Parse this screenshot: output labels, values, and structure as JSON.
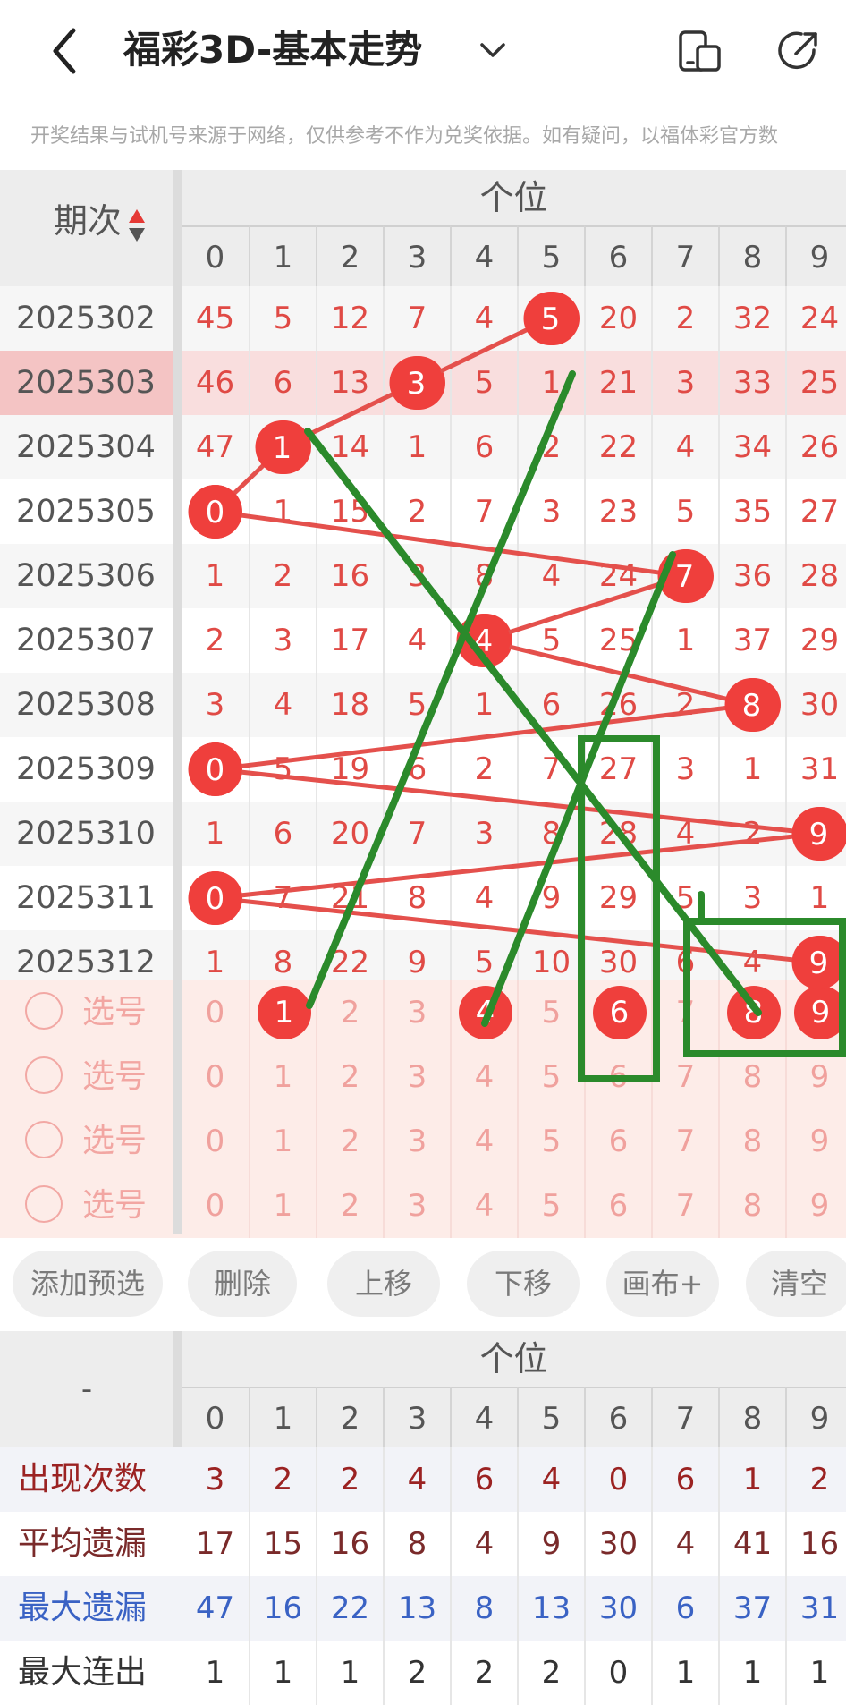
{
  "header": {
    "title": "福彩3D-基本走势",
    "icons": [
      "back-arrow-icon",
      "chevron-down-icon",
      "phone-layout-icon",
      "share-icon"
    ]
  },
  "disclaimer": "开奖结果与试机号来源于网络，仅供参考不作为兑奖依据。如有疑问，以福体彩官方数",
  "table": {
    "issue_header": "期次",
    "group_header": "个位",
    "columns": [
      "0",
      "1",
      "2",
      "3",
      "4",
      "5",
      "6",
      "7",
      "8",
      "9"
    ],
    "rows": [
      {
        "issue": "2025302",
        "values": [
          "45",
          "5",
          "12",
          "7",
          "4",
          "5",
          "20",
          "2",
          "32",
          "24"
        ],
        "hit": 5
      },
      {
        "issue": "2025303",
        "values": [
          "46",
          "6",
          "13",
          "3",
          "5",
          "1",
          "21",
          "3",
          "33",
          "25"
        ],
        "hit": 3
      },
      {
        "issue": "2025304",
        "values": [
          "47",
          "1",
          "14",
          "1",
          "6",
          "2",
          "22",
          "4",
          "34",
          "26"
        ],
        "hit": 1
      },
      {
        "issue": "2025305",
        "values": [
          "0",
          "1",
          "15",
          "2",
          "7",
          "3",
          "23",
          "5",
          "35",
          "27"
        ],
        "hit": 0
      },
      {
        "issue": "2025306",
        "values": [
          "1",
          "2",
          "16",
          "3",
          "8",
          "4",
          "24",
          "7",
          "36",
          "28"
        ],
        "hit": 7
      },
      {
        "issue": "2025307",
        "values": [
          "2",
          "3",
          "17",
          "4",
          "4",
          "5",
          "25",
          "1",
          "37",
          "29"
        ],
        "hit": 4
      },
      {
        "issue": "2025308",
        "values": [
          "3",
          "4",
          "18",
          "5",
          "1",
          "6",
          "26",
          "2",
          "8",
          "30"
        ],
        "hit": 8
      },
      {
        "issue": "2025309",
        "values": [
          "0",
          "5",
          "19",
          "6",
          "2",
          "7",
          "27",
          "3",
          "1",
          "31"
        ],
        "hit": 0
      },
      {
        "issue": "2025310",
        "values": [
          "1",
          "6",
          "20",
          "7",
          "3",
          "8",
          "28",
          "4",
          "2",
          "9"
        ],
        "hit": 9
      },
      {
        "issue": "2025311",
        "values": [
          "0",
          "7",
          "21",
          "8",
          "4",
          "9",
          "29",
          "5",
          "3",
          "1"
        ],
        "hit": 0
      },
      {
        "issue": "2025312",
        "values": [
          "1",
          "8",
          "22",
          "9",
          "5",
          "10",
          "30",
          "6",
          "4",
          "9"
        ],
        "hit": 9
      }
    ],
    "pick_rows": [
      {
        "label": "选号",
        "selected": [
          1,
          4,
          6,
          8,
          9
        ]
      },
      {
        "label": "选号",
        "selected": []
      },
      {
        "label": "选号",
        "selected": []
      },
      {
        "label": "选号",
        "selected": []
      }
    ]
  },
  "actions": [
    "添加预选",
    "删除",
    "上移",
    "下移",
    "画布+",
    "清空"
  ],
  "stats": {
    "corner": "-",
    "group_header": "个位",
    "columns": [
      "0",
      "1",
      "2",
      "3",
      "4",
      "5",
      "6",
      "7",
      "8",
      "9"
    ],
    "rows": [
      {
        "label": "出现次数",
        "values": [
          "3",
          "2",
          "2",
          "4",
          "6",
          "4",
          "0",
          "6",
          "1",
          "2"
        ],
        "color": "#9b2222"
      },
      {
        "label": "平均遗漏",
        "values": [
          "17",
          "15",
          "16",
          "8",
          "4",
          "9",
          "30",
          "4",
          "41",
          "16"
        ],
        "color": "#7a2a2a"
      },
      {
        "label": "最大遗漏",
        "values": [
          "47",
          "16",
          "22",
          "13",
          "8",
          "13",
          "30",
          "6",
          "37",
          "31"
        ],
        "color": "#3a62c4"
      },
      {
        "label": "最大连出",
        "values": [
          "1",
          "1",
          "1",
          "2",
          "2",
          "2",
          "0",
          "1",
          "1",
          "1"
        ],
        "color": "#333333"
      }
    ]
  },
  "colors": {
    "ball": "#ef3f3c",
    "trend_line": "#e4504c",
    "user_drawing": "#2b8a2b",
    "highlight_row": "#f9dede",
    "pick_bg": "#fdece8"
  }
}
